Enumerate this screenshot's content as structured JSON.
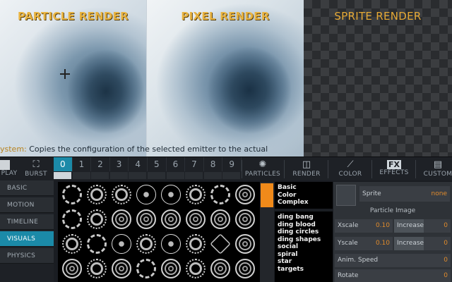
{
  "viewports": {
    "particle_title": "PARTICLE RENDER",
    "pixel_title": "PIXEL RENDER",
    "sprite_title": "SPRITE RENDER"
  },
  "status": {
    "prefix": "ystem:",
    "message": " Copies the configuration of the selected emitter to the actual"
  },
  "toolbar": {
    "play_label": "PLAY",
    "burst_label": "BURST",
    "emitters": [
      "0",
      "1",
      "2",
      "3",
      "4",
      "5",
      "6",
      "7",
      "8",
      "9"
    ],
    "active_emitter": 0,
    "particles_label": "PARTICLES",
    "render_label": "RENDER",
    "color_label": "COLOR",
    "effects_label": "EFFECTS",
    "effects_icon_text": "FX",
    "custom_label": "CUSTOM"
  },
  "sidemenu": {
    "items": [
      "BASIC",
      "MOTION",
      "TIMELINE",
      "VISUALS",
      "PHYSICS"
    ],
    "active": "VISUALS"
  },
  "categories": [
    "Basic",
    "Color",
    "Complex"
  ],
  "shape_list": [
    "ding bang",
    "ding blood",
    "ding circles",
    "ding shapes",
    "social",
    "spiral",
    "star",
    "targets"
  ],
  "right_panel": {
    "sprite_label": "Sprite",
    "sprite_value": "none",
    "section_title": "Particle Image",
    "xscale_label": "Xscale",
    "xscale_value": "0.10",
    "x_increase_label": "Increase",
    "x_increase_value": "0",
    "yscale_label": "Yscale",
    "yscale_value": "0.10",
    "y_increase_label": "Increase",
    "y_increase_value": "0",
    "anim_speed_label": "Anim. Speed",
    "anim_speed_value": "0",
    "rotate_label": "Rotate",
    "rotate_value": "0"
  },
  "colors": {
    "accent": "#1b8aa8",
    "title_gold": "#e8b341",
    "value_orange": "#e08b2c",
    "scroll_thumb": "#f08a1a"
  }
}
